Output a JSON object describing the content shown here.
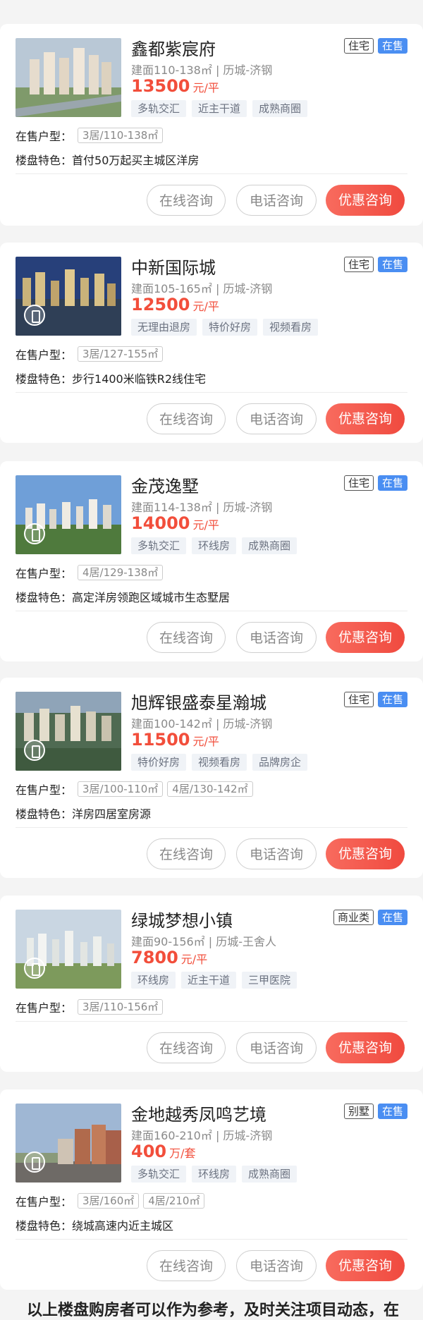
{
  "listings": [
    {
      "title": "鑫都紫宸府",
      "type_badge": "住宅",
      "status_badge": "在售",
      "meta": "建面110-138㎡ | 历城-济钢",
      "price": "13500",
      "price_unit": "元/平",
      "tags": [
        "多轨交汇",
        "近主干道",
        "成熟商圈"
      ],
      "units_label": "在售户型：",
      "units": [
        "3居/110-138㎡"
      ],
      "feature_label": "楼盘特色：",
      "feature": "首付50万起买主城区洋房",
      "btn_online": "在线咨询",
      "btn_phone": "电话咨询",
      "btn_promo": "优惠咨询"
    },
    {
      "title": "中新国际城",
      "type_badge": "住宅",
      "status_badge": "在售",
      "meta": "建面105-165㎡ | 历城-济钢",
      "price": "12500",
      "price_unit": "元/平",
      "tags": [
        "无理由退房",
        "特价好房",
        "视频看房"
      ],
      "units_label": "在售户型：",
      "units": [
        "3居/127-155㎡"
      ],
      "feature_label": "楼盘特色：",
      "feature": "步行1400米临铁R2线住宅",
      "btn_online": "在线咨询",
      "btn_phone": "电话咨询",
      "btn_promo": "优惠咨询"
    },
    {
      "title": "金茂逸墅",
      "type_badge": "住宅",
      "status_badge": "在售",
      "meta": "建面114-138㎡ | 历城-济钢",
      "price": "14000",
      "price_unit": "元/平",
      "tags": [
        "多轨交汇",
        "环线房",
        "成熟商圈"
      ],
      "units_label": "在售户型：",
      "units": [
        "4居/129-138㎡"
      ],
      "feature_label": "楼盘特色：",
      "feature": "高定洋房领跑区域城市生态墅居",
      "btn_online": "在线咨询",
      "btn_phone": "电话咨询",
      "btn_promo": "优惠咨询"
    },
    {
      "title": "旭辉银盛泰星瀚城",
      "type_badge": "住宅",
      "status_badge": "在售",
      "meta": "建面100-142㎡ | 历城-济钢",
      "price": "11500",
      "price_unit": "元/平",
      "tags": [
        "特价好房",
        "视频看房",
        "品牌房企"
      ],
      "units_label": "在售户型：",
      "units": [
        "3居/100-110㎡",
        "4居/130-142㎡"
      ],
      "feature_label": "楼盘特色：",
      "feature": "洋房四居室房源",
      "btn_online": "在线咨询",
      "btn_phone": "电话咨询",
      "btn_promo": "优惠咨询"
    },
    {
      "title": "绿城梦想小镇",
      "type_badge": "商业类",
      "status_badge": "在售",
      "meta": "建面90-156㎡ | 历城-王舍人",
      "price": "7800",
      "price_unit": "元/平",
      "tags": [
        "环线房",
        "近主干道",
        "三甲医院"
      ],
      "units_label": "在售户型：",
      "units": [
        "3居/110-156㎡"
      ],
      "btn_online": "在线咨询",
      "btn_phone": "电话咨询",
      "btn_promo": "优惠咨询"
    },
    {
      "title": "金地越秀凤鸣艺境",
      "type_badge": "别墅",
      "status_badge": "在售",
      "meta": "建面160-210㎡ | 历城-济钢",
      "price": "400",
      "price_unit": "万/套",
      "tags": [
        "多轨交汇",
        "环线房",
        "成熟商圈"
      ],
      "units_label": "在售户型：",
      "units": [
        "3居/160㎡",
        "4居/210㎡"
      ],
      "feature_label": "楼盘特色：",
      "feature": "绕城高速内近主城区",
      "btn_online": "在线咨询",
      "btn_phone": "电话咨询",
      "btn_promo": "优惠咨询"
    }
  ],
  "footer_text": "以上楼盘购房者可以作为参考，及时关注项目动态，在"
}
